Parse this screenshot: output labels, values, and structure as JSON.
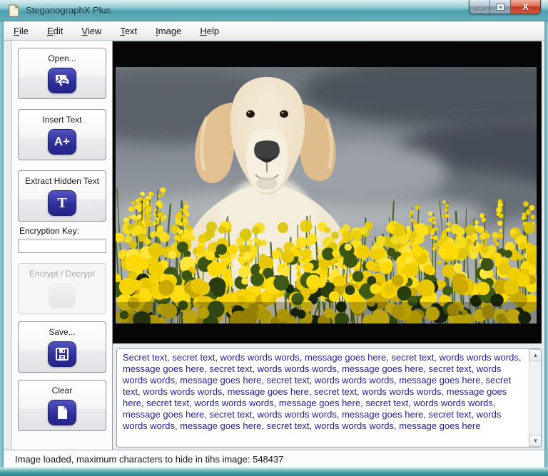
{
  "window": {
    "title": "SteganographX Plus",
    "controls": {
      "minimize": "minimize",
      "maximize": "maximize",
      "close": "close"
    }
  },
  "menu": {
    "items": [
      {
        "label": "File"
      },
      {
        "label": "Edit"
      },
      {
        "label": "View"
      },
      {
        "label": "Text"
      },
      {
        "label": "Image"
      },
      {
        "label": "Help"
      }
    ]
  },
  "sidebar": {
    "open_label": "Open...",
    "insert_label": "Insert Text",
    "extract_label": "Extract Hidden Text",
    "encryption_key_label": "Encryption Key:",
    "encryption_key_value": "",
    "encrypt_label": "Encrypt / Decrypt",
    "save_label": "Save...",
    "clear_label": "Clear"
  },
  "photo": {
    "alt": "Golden retriever dog sitting in a field of yellow rapeseed flowers under a dark stormy gray sky"
  },
  "message": {
    "text": "Secret text, secret text, words words words, message goes here, secret text, words words words, message goes here, secret text, words words words, message goes here, secret text, words words words, message goes here, secret text, words words words, message goes here, secret text, words words words, message goes here, secret text, words words words, message goes here, secret text, words words words, message goes here, secret text, words words words, message goes here, secret text, words words words, message goes here, secret text, words words words, message goes here, secret text, words words words, message goes here"
  },
  "status": {
    "text": "Image loaded, maximum characters to hide in tihs image: 548437"
  },
  "colors": {
    "titlebar_teal": "#58a7b5",
    "frame_teal": "#2f8e96",
    "icon_blue": "#2d2d95",
    "message_navy": "#20209a",
    "close_red": "#c13a28",
    "flower_yellow": "#ffd903",
    "stem_green": "#3e5a14",
    "sky_gray": "#8d939a"
  }
}
